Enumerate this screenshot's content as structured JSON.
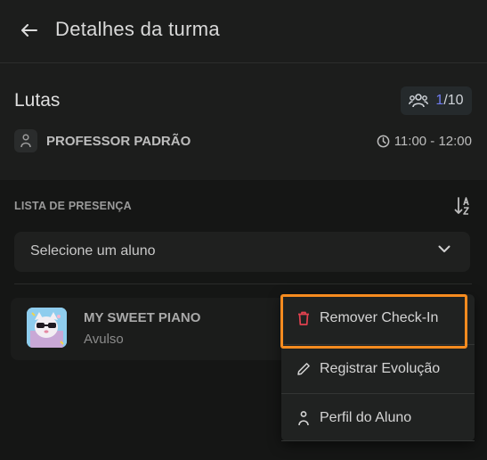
{
  "header": {
    "title": "Detalhes da turma"
  },
  "class_info": {
    "name": "Lutas",
    "capacity_current": "1",
    "capacity_total": "/10",
    "professor": "PROFESSOR PADRÃO",
    "time": "11:00 - 12:00"
  },
  "attendance": {
    "title": "LISTA DE PRESENÇA",
    "select_placeholder": "Selecione um aluno",
    "students": [
      {
        "name": "MY SWEET PIANO",
        "plan": "Avulso"
      }
    ]
  },
  "context_menu": {
    "items": [
      {
        "label": "Remover Check-In",
        "icon": "trash-icon",
        "icon_color": "#e0414f"
      },
      {
        "label": "Registrar Evolução",
        "icon": "pencil-icon"
      },
      {
        "label": "Perfil do Aluno",
        "icon": "person-icon"
      }
    ]
  },
  "colors": {
    "accent_capacity": "#6f7cf0",
    "highlight": "#f68b1f",
    "danger": "#e0414f"
  }
}
